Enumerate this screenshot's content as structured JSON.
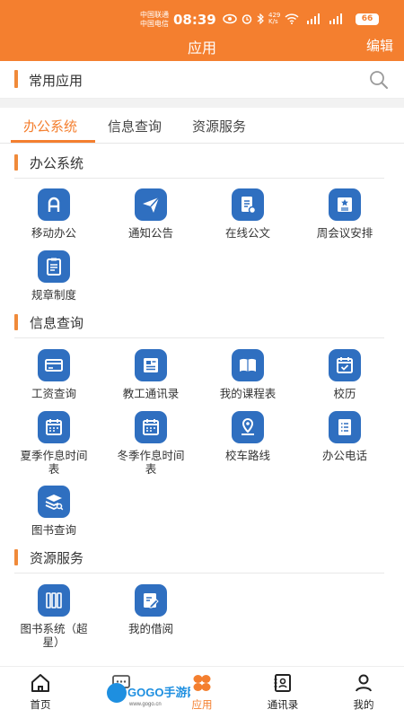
{
  "status_bar": {
    "carrier_1": "中国联通",
    "carrier_2": "中国电信",
    "time": "08:39",
    "network_speed_value": "429",
    "network_speed_unit": "K/s",
    "battery": "66"
  },
  "header": {
    "title": "应用",
    "edit_label": "编辑"
  },
  "favorites": {
    "title": "常用应用"
  },
  "tabs": [
    {
      "label": "办公系统",
      "active": true
    },
    {
      "label": "信息查询",
      "active": false
    },
    {
      "label": "资源服务",
      "active": false
    }
  ],
  "sections": [
    {
      "title": "办公系统",
      "apps": [
        {
          "label": "移动办公",
          "icon": "mobile-office-icon"
        },
        {
          "label": "通知公告",
          "icon": "paper-plane-icon"
        },
        {
          "label": "在线公文",
          "icon": "document-icon"
        },
        {
          "label": "周会议安排",
          "icon": "meeting-board-icon"
        },
        {
          "label": "规章制度",
          "icon": "rules-icon"
        }
      ]
    },
    {
      "title": "信息查询",
      "apps": [
        {
          "label": "工资查询",
          "icon": "card-icon"
        },
        {
          "label": "教工通讯录",
          "icon": "directory-icon"
        },
        {
          "label": "我的课程表",
          "icon": "book-icon"
        },
        {
          "label": "校历",
          "icon": "calendar-check-icon"
        },
        {
          "label": "夏季作息时间表",
          "icon": "calendar-icon"
        },
        {
          "label": "冬季作息时间表",
          "icon": "calendar-icon"
        },
        {
          "label": "校车路线",
          "icon": "location-pin-icon"
        },
        {
          "label": "办公电话",
          "icon": "phone-list-icon"
        },
        {
          "label": "图书查询",
          "icon": "book-search-icon"
        }
      ]
    },
    {
      "title": "资源服务",
      "apps": [
        {
          "label": "图书系统（超星）",
          "icon": "book-shelf-icon"
        },
        {
          "label": "我的借阅",
          "icon": "borrow-icon"
        }
      ]
    }
  ],
  "bottom_nav": [
    {
      "label": "首页",
      "icon": "home-icon",
      "active": false
    },
    {
      "label": "消息",
      "icon": "message-icon",
      "active": false
    },
    {
      "label": "应用",
      "icon": "apps-icon",
      "active": true
    },
    {
      "label": "通讯录",
      "icon": "contacts-icon",
      "active": false
    },
    {
      "label": "我的",
      "icon": "profile-icon",
      "active": false
    }
  ],
  "watermark": {
    "text": "GOGO手游网",
    "url": "www.gogo.cn"
  },
  "colors": {
    "accent": "#f47f2f",
    "icon_blue": "#2f6fc0"
  }
}
